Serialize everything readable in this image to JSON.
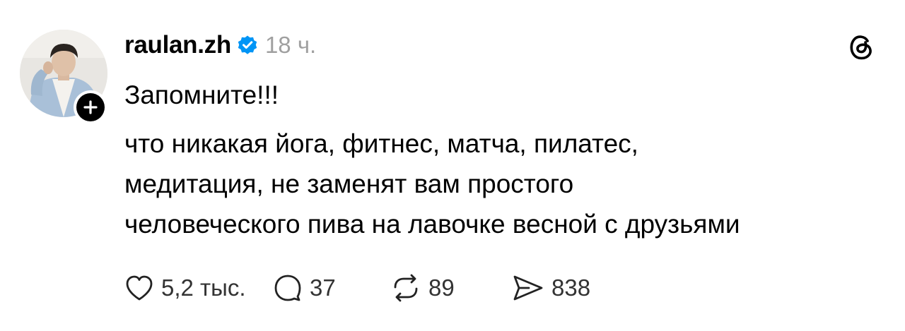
{
  "post": {
    "author": {
      "username": "raulan.zh",
      "verified": true,
      "avatar_alt": "profile photo"
    },
    "time": "18 ч.",
    "headline": "Запомните!!!",
    "lines": [
      "что никакая йога, фитнес, матча, пилатес,",
      "медитация, не заменят вам простого",
      "человеческого пива на лавочке весной с друзьями"
    ],
    "actions": {
      "likes": "5,2 тыс.",
      "replies": "37",
      "reposts": "89",
      "shares": "838"
    }
  },
  "icons": {
    "follow": "plus-icon",
    "verified": "verified-badge-icon",
    "app": "threads-logo-icon",
    "like": "heart-icon",
    "reply": "speech-bubble-icon",
    "repost": "repost-arrows-icon",
    "share": "send-icon"
  },
  "colors": {
    "text": "#000000",
    "muted": "#a0a0a0",
    "verified_blue": "#0095f6",
    "background": "#ffffff"
  }
}
